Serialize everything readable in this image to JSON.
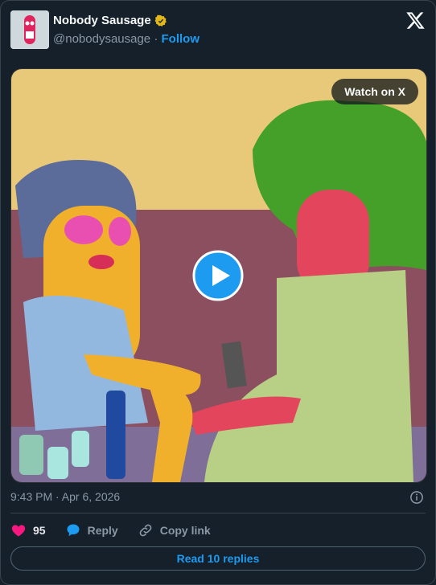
{
  "author": {
    "name": "Nobody Sausage",
    "handle": "@nobodysausage",
    "separator": "·",
    "follow_label": "Follow"
  },
  "media": {
    "watch_label": "Watch on X"
  },
  "timestamp": "9:43 PM · Apr 6, 2026",
  "actions": {
    "likes": "95",
    "reply_label": "Reply",
    "copy_label": "Copy link"
  },
  "read_replies_label": "Read 10 replies",
  "colors": {
    "background": "#15202b",
    "accent": "#1d9bf0",
    "heart": "#f91880",
    "verified": "#e2b719"
  }
}
